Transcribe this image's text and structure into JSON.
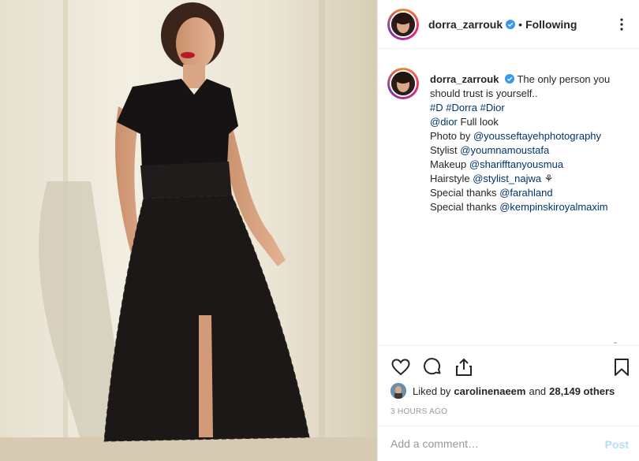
{
  "photo": {
    "alt_icon": "post-photo"
  },
  "header": {
    "username": "dorra_zarrouk",
    "separator": "•",
    "follow_state": "Following"
  },
  "caption": {
    "username": "dorra_zarrouk",
    "text_line1": "The only person you",
    "text_line2": "should trust is yourself..",
    "hashtags": [
      "#D",
      "#Dorra",
      "#Dior"
    ],
    "dior_mention": "@dior",
    "dior_suffix": "Full look",
    "photo_prefix": "Photo by",
    "photo_mention": "@youssef​tayehphotography",
    "stylist_prefix": "Stylist",
    "stylist_mention": "@youmnamoustafa",
    "makeup_prefix": "Makeup",
    "makeup_mention": "@shariff​tanyousmua",
    "hair_prefix": "Hairstyle",
    "hair_mention": "@stylist_najwa",
    "hair_emoji": "⚘",
    "thanks1_prefix": "Special thanks",
    "thanks1_mention": "@farahland",
    "thanks2_prefix": "Special thanks",
    "thanks2_mention": "@kempinskiroyalmaxim"
  },
  "likes": {
    "prefix": "Liked by",
    "user": "carolinenaeem",
    "middle": "and",
    "count": "28,149 others"
  },
  "timestamp": "3 HOURS AGO",
  "comment": {
    "placeholder": "Add a comment…",
    "post_label": "Post"
  },
  "colors": {
    "link": "#003569",
    "verified": "#3897f0",
    "post_disabled": "#b2dffc",
    "muted": "#999999"
  }
}
